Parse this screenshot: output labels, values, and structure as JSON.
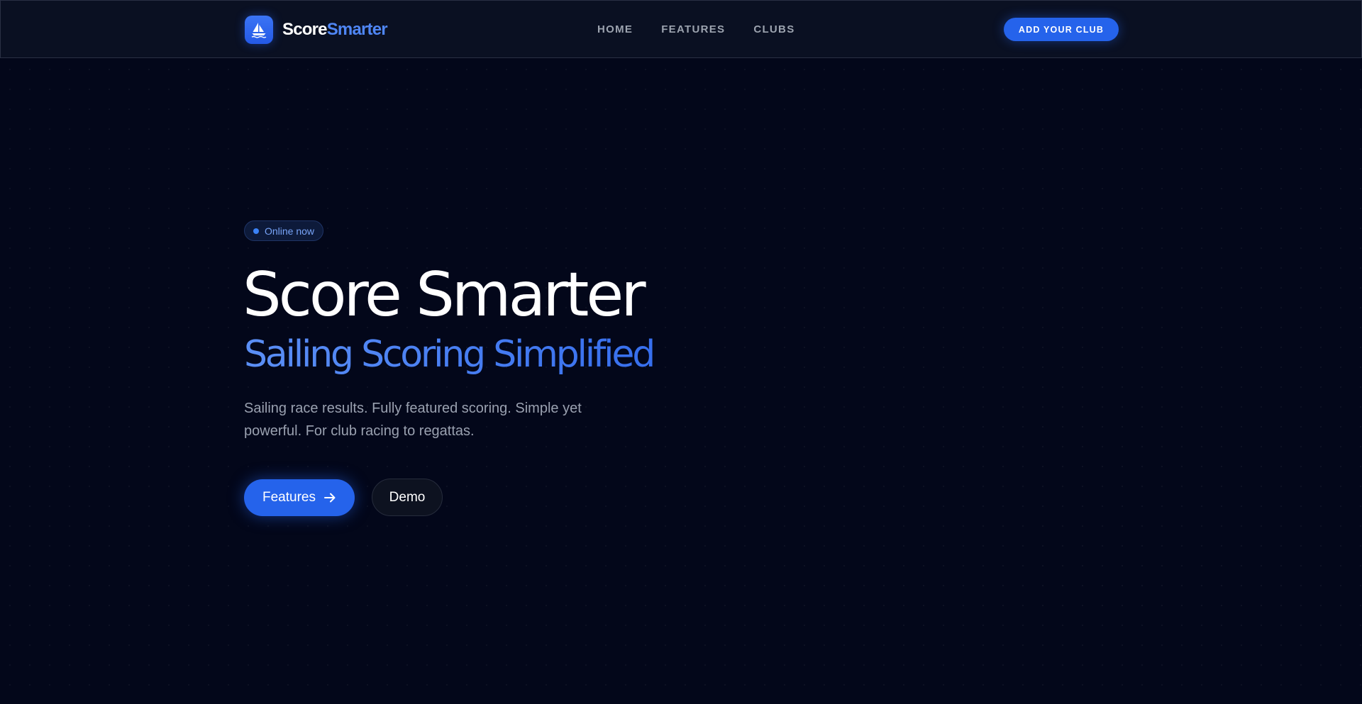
{
  "brand": {
    "name_part1": "Score",
    "name_part2": "Smarter",
    "logo_icon": "sailboat-icon"
  },
  "nav": {
    "links": [
      {
        "label": "HOME"
      },
      {
        "label": "FEATURES"
      },
      {
        "label": "CLUBS"
      }
    ],
    "cta_label": "ADD YOUR CLUB"
  },
  "hero": {
    "badge": "Online now",
    "title": "Score Smarter",
    "subtitle": "Sailing Scoring Simplified",
    "description": "Sailing race results. Fully featured scoring. Simple yet powerful. For club racing to regattas.",
    "primary_button": "Features",
    "primary_button_icon": "arrow-right-icon",
    "secondary_button": "Demo"
  },
  "colors": {
    "background": "#03071a",
    "accent": "#2563eb",
    "accent_text": "#4f86f5",
    "muted_text": "#9aa1b0"
  }
}
